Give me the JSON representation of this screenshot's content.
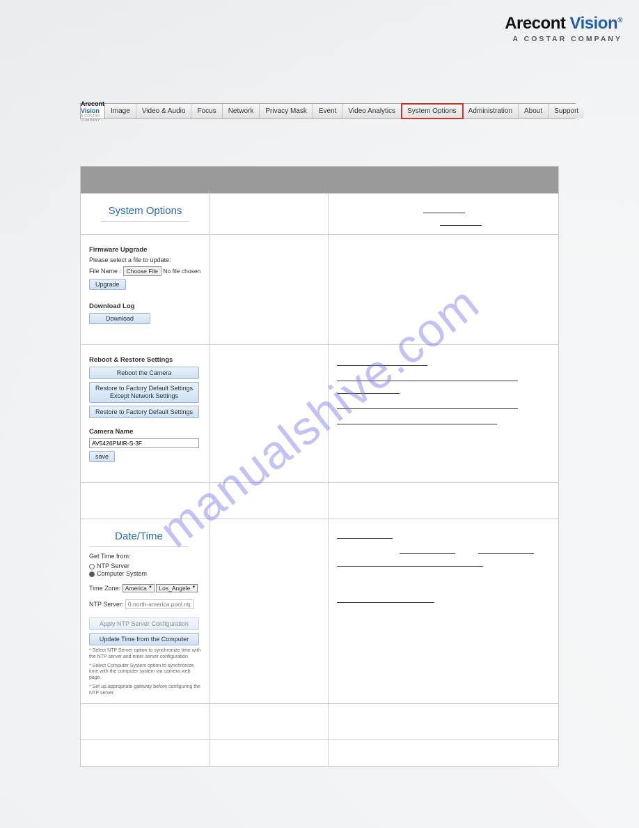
{
  "brand": {
    "word1": "Arecont",
    "word2": "Vision",
    "reg": "®",
    "sub": "A COSTAR COMPANY"
  },
  "watermark": "manualshive.com",
  "nav": {
    "logo_line1": "Arecont Vision",
    "logo_line2": "A COSTAR COMPANY",
    "items": [
      {
        "label": "Image",
        "sel": false
      },
      {
        "label": "Video & Audio",
        "sel": false
      },
      {
        "label": "Focus",
        "sel": false
      },
      {
        "label": "Network",
        "sel": false
      },
      {
        "label": "Privacy Mask",
        "sel": false
      },
      {
        "label": "Event",
        "sel": false
      },
      {
        "label": "Video Analytics",
        "sel": false
      },
      {
        "label": "System Options",
        "sel": true
      },
      {
        "label": "Administration",
        "sel": false
      },
      {
        "label": "About",
        "sel": false
      },
      {
        "label": "Support",
        "sel": false
      }
    ]
  },
  "system_options": {
    "title": "System Options",
    "firmware_h": "Firmware Upgrade",
    "firmware_prompt": "Please select a file to update:",
    "file_name_label": "File Name :",
    "choose_file": "Choose File",
    "no_file": "No file chosen",
    "upgrade_btn": "Upgrade",
    "download_log_h": "Download Log",
    "download_btn": "Download",
    "reboot_h": "Reboot & Restore Settings",
    "reboot_btn": "Reboot the Camera",
    "restore_except_btn": "Restore to Factory Default Settings Except Network Settings",
    "restore_all_btn": "Restore to Factory Default Settings",
    "camera_name_h": "Camera Name",
    "camera_name_value": "AV5426PMIR-S-3F",
    "save_btn": "save"
  },
  "datetime": {
    "title": "Date/Time",
    "get_time_h": "Get Time from:",
    "ntp_radio": "NTP Server",
    "computer_radio": "Computer System",
    "tz_label": "Time Zone:",
    "tz_region": "America",
    "tz_city": "Los_Angele",
    "ntp_label": "NTP Server:",
    "ntp_value": "0.north-america.pool.ntp",
    "apply_ntp_btn": "Apply NTP Server Configuration",
    "update_computer_btn": "Update Time from the Computer",
    "note1": "* Select NTP Server option to synchronize time with the NTP server and enter server configuration.",
    "note2": "* Select Computer System option to synchronize time with the computer system via camera web page.",
    "note3": "* Set up appropriate gateway before configuring the NTP server."
  }
}
